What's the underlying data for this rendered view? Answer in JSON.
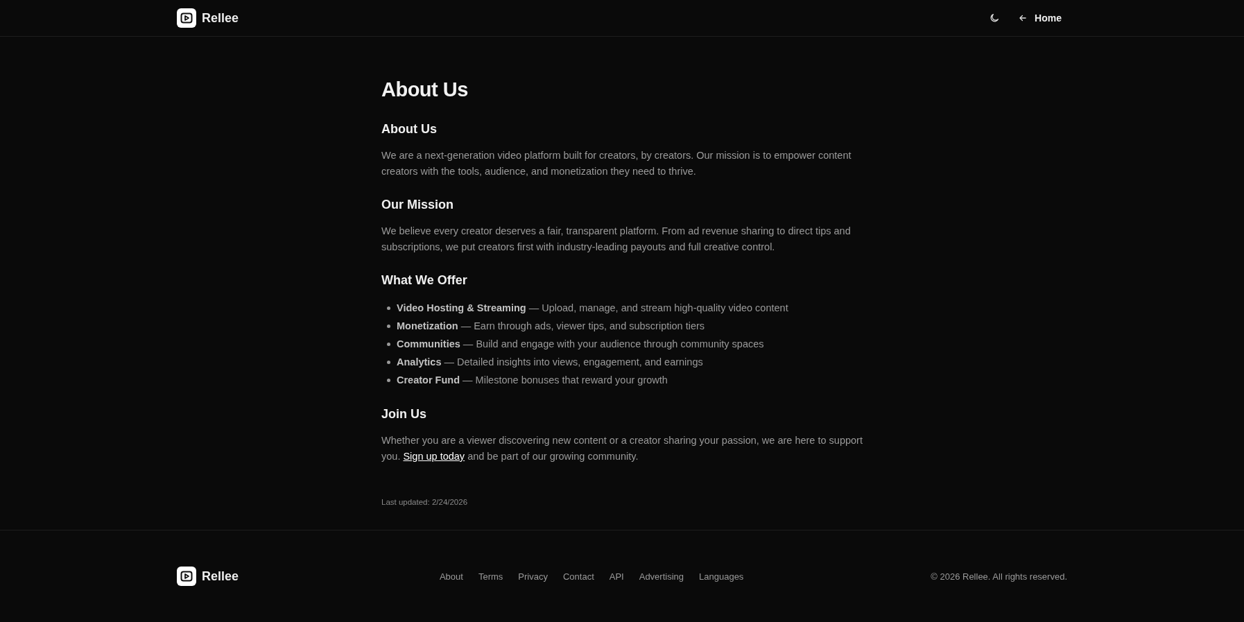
{
  "header": {
    "brand": "Rellee",
    "home_link": "Home"
  },
  "page": {
    "title": "About Us",
    "sections": [
      {
        "kind": "paragraph",
        "heading": "About Us",
        "text": "We are a next-generation video platform built for creators, by creators. Our mission is to empower content creators with the tools, audience, and monetization they need to thrive."
      },
      {
        "kind": "paragraph",
        "heading": "Our Mission",
        "text": "We believe every creator deserves a fair, transparent platform. From ad revenue sharing to direct tips and subscriptions, we put creators first with industry-leading payouts and full creative control."
      },
      {
        "kind": "list",
        "heading": "What We Offer",
        "items": [
          "**Video Hosting & Streaming** — Upload, manage, and stream high-quality video content",
          "**Monetization** — Earn through ads, viewer tips, and subscription tiers",
          "**Communities** — Build and engage with your audience through community spaces",
          "**Analytics** — Detailed insights into views, engagement, and earnings",
          "**Creator Fund** — Milestone bonuses that reward your growth"
        ]
      },
      {
        "kind": "link_paragraph",
        "heading": "Join Us",
        "before": "Whether you are a viewer discovering new content or a creator sharing your passion, we are here to support you.",
        "link": "Sign up today",
        "after": "and be part of our growing community."
      }
    ],
    "last_updated": "Last updated: 2/24/2026"
  },
  "footer": {
    "brand": "Rellee",
    "links": [
      "About",
      "Terms",
      "Privacy",
      "Contact",
      "API",
      "Advertising",
      "Languages"
    ],
    "copyright": "© 2026 Rellee. All rights reserved."
  }
}
